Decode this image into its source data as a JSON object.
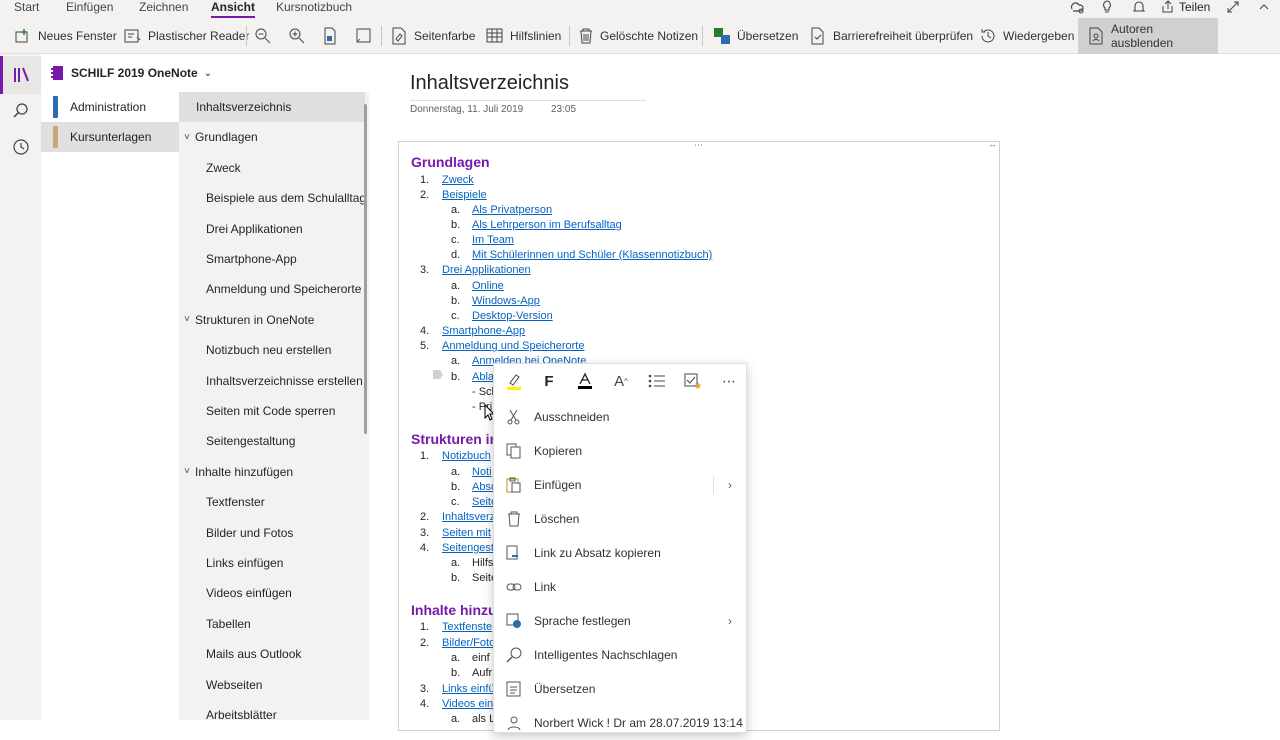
{
  "tabs": [
    "Start",
    "Einfügen",
    "Zeichnen",
    "Ansicht",
    "Kursnotizbuch"
  ],
  "tab_active": "Ansicht",
  "title_right": {
    "share_label": "Teilen"
  },
  "toolbar": {
    "neues_fenster": "Neues Fenster",
    "plastischer_reader": "Plastischer Reader",
    "seitenfarbe": "Seitenfarbe",
    "hilfslinien": "Hilfslinien",
    "geloeschte_notizen": "Gelöschte Notizen",
    "uebersetzen": "Übersetzen",
    "barrierefreiheit": "Barrierefreiheit überprüfen",
    "wiedergeben": "Wiedergeben",
    "autoren_ausblenden": "Autoren ausblenden"
  },
  "notebook": {
    "name": "SCHILF 2019 OneNote"
  },
  "sections": [
    {
      "label": "Administration",
      "color": "#2b6cb0"
    },
    {
      "label": "Kursunterlagen",
      "color": "#c4a87a"
    }
  ],
  "pages": [
    {
      "label": "Inhaltsverzeichnis",
      "level": 0
    },
    {
      "label": "Grundlagen",
      "level": 0,
      "group": true
    },
    {
      "label": "Zweck",
      "level": 1
    },
    {
      "label": "Beispiele aus dem Schulalltag",
      "level": 1
    },
    {
      "label": "Drei Applikationen",
      "level": 1
    },
    {
      "label": "Smartphone-App",
      "level": 1
    },
    {
      "label": "Anmeldung und Speicherorte",
      "level": 1
    },
    {
      "label": "Strukturen in OneNote",
      "level": 0,
      "group": true
    },
    {
      "label": "Notizbuch neu erstellen",
      "level": 1
    },
    {
      "label": "Inhaltsverzeichnisse erstellen",
      "level": 1
    },
    {
      "label": "Seiten mit Code sperren",
      "level": 1
    },
    {
      "label": "Seitengestaltung",
      "level": 1
    },
    {
      "label": "Inhalte hinzufügen",
      "level": 0,
      "group": true
    },
    {
      "label": "Textfenster",
      "level": 1
    },
    {
      "label": "Bilder und Fotos",
      "level": 1
    },
    {
      "label": "Links einfügen",
      "level": 1
    },
    {
      "label": "Videos einfügen",
      "level": 1
    },
    {
      "label": "Tabellen",
      "level": 1
    },
    {
      "label": "Mails aus Outlook",
      "level": 1
    },
    {
      "label": "Webseiten",
      "level": 1
    },
    {
      "label": "Arbeitsblätter",
      "level": 1
    }
  ],
  "page": {
    "title": "Inhaltsverzeichnis",
    "date": "Donnerstag, 11. Juli 2019",
    "time": "23:05"
  },
  "note": {
    "headings": [
      "Grundlagen",
      "Strukturen ir",
      "Inhalte hinzu"
    ],
    "lines": [
      {
        "num": "1.",
        "text": "Zweck",
        "link": true,
        "level": 1
      },
      {
        "num": "2.",
        "text": "Beispiele",
        "link": true,
        "level": 1
      },
      {
        "num": "a.",
        "text": "Als Privatperson",
        "link": true,
        "level": 2
      },
      {
        "num": "b.",
        "text": "Als Lehrperson im Berufsalltag",
        "link": true,
        "level": 2
      },
      {
        "num": "c.",
        "text": "Im Team",
        "link": true,
        "level": 2
      },
      {
        "num": "d.",
        "text": "Mit Schülerinnen und Schüler (Klassennotizbuch)",
        "link": true,
        "level": 2
      },
      {
        "num": "3.",
        "text": "Drei Applikationen",
        "link": true,
        "level": 1
      },
      {
        "num": "a.",
        "text": "Online",
        "link": true,
        "level": 2
      },
      {
        "num": "b.",
        "text": "Windows-App",
        "link": true,
        "level": 2
      },
      {
        "num": "c.",
        "text": "Desktop-Version",
        "link": true,
        "level": 2
      },
      {
        "num": "4.",
        "text": "Smartphone-App",
        "link": true,
        "level": 1
      },
      {
        "num": "5.",
        "text": "Anmeldung und Speicherorte",
        "link": true,
        "level": 1
      },
      {
        "num": "a.",
        "text": "Anmelden bei OneNote",
        "link": true,
        "level": 2
      },
      {
        "num": "b.",
        "text": "Abla",
        "link": true,
        "level": 2
      },
      {
        "num": "",
        "text": "- Sch",
        "link": false,
        "level": 3
      },
      {
        "num": "",
        "text": "- Pri",
        "link": false,
        "level": 3
      },
      {
        "num": "1.",
        "text": "Notizbuch",
        "link": true,
        "level": 1
      },
      {
        "num": "a.",
        "text": "Noti",
        "link": true,
        "level": 2
      },
      {
        "num": "b.",
        "text": "Abso",
        "link": true,
        "level": 2
      },
      {
        "num": "c.",
        "text": "Seite",
        "link": true,
        "level": 2
      },
      {
        "num": "2.",
        "text": "Inhaltsverze",
        "link": true,
        "level": 1
      },
      {
        "num": "3.",
        "text": "Seiten mit",
        "link": true,
        "level": 1
      },
      {
        "num": "4.",
        "text": "Seitengest",
        "link": true,
        "level": 1
      },
      {
        "num": "a.",
        "text": "Hilfs",
        "link": false,
        "level": 2
      },
      {
        "num": "b.",
        "text": "Seite",
        "link": false,
        "level": 2
      },
      {
        "num": "1.",
        "text": "Textfenste",
        "link": true,
        "level": 1
      },
      {
        "num": "2.",
        "text": "Bilder/Foto",
        "link": true,
        "level": 1
      },
      {
        "num": "a.",
        "text": "einf",
        "link": false,
        "level": 2
      },
      {
        "num": "b.",
        "text": "Aufr",
        "link": false,
        "level": 2
      },
      {
        "num": "3.",
        "text": "Links einfü",
        "link": true,
        "level": 1
      },
      {
        "num": "4.",
        "text": "Videos ein",
        "link": true,
        "level": 1
      },
      {
        "num": "a.",
        "text": "als L",
        "link": false,
        "level": 2
      }
    ]
  },
  "context_menu": {
    "items": [
      {
        "label": "Ausschneiden",
        "icon": "scissors-icon"
      },
      {
        "label": "Kopieren",
        "icon": "copy-icon"
      },
      {
        "label": "Einfügen",
        "icon": "paste-icon",
        "submenu": true
      },
      {
        "label": "Löschen",
        "icon": "trash-icon"
      },
      {
        "label": "Link zu Absatz kopieren",
        "icon": "link-copy-icon"
      },
      {
        "label": "Link",
        "icon": "link-icon"
      },
      {
        "label": "Sprache festlegen",
        "icon": "language-icon",
        "submenu": true
      },
      {
        "label": "Intelligentes Nachschlagen",
        "icon": "smart-lookup-icon"
      },
      {
        "label": "Übersetzen",
        "icon": "translate-icon"
      },
      {
        "label": "Norbert Wick ! Dr am 28.07.2019 13:14",
        "icon": "author-icon"
      }
    ]
  },
  "colors": {
    "accent": "#7719aa",
    "link": "#0563c1"
  }
}
